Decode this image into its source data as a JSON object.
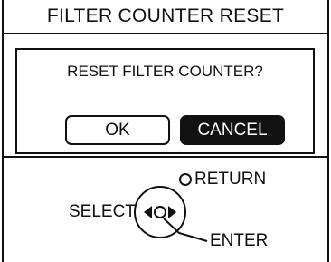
{
  "title": "FILTER COUNTER RESET",
  "dialog": {
    "message": "RESET FILTER COUNTER?",
    "ok_label": "OK",
    "cancel_label": "CANCEL",
    "selected": "CANCEL"
  },
  "legend": {
    "return_label": "RETURN",
    "select_label": "SELECT",
    "enter_label": "ENTER"
  },
  "colors": {
    "foreground": "#111111",
    "background": "#ffffff"
  }
}
